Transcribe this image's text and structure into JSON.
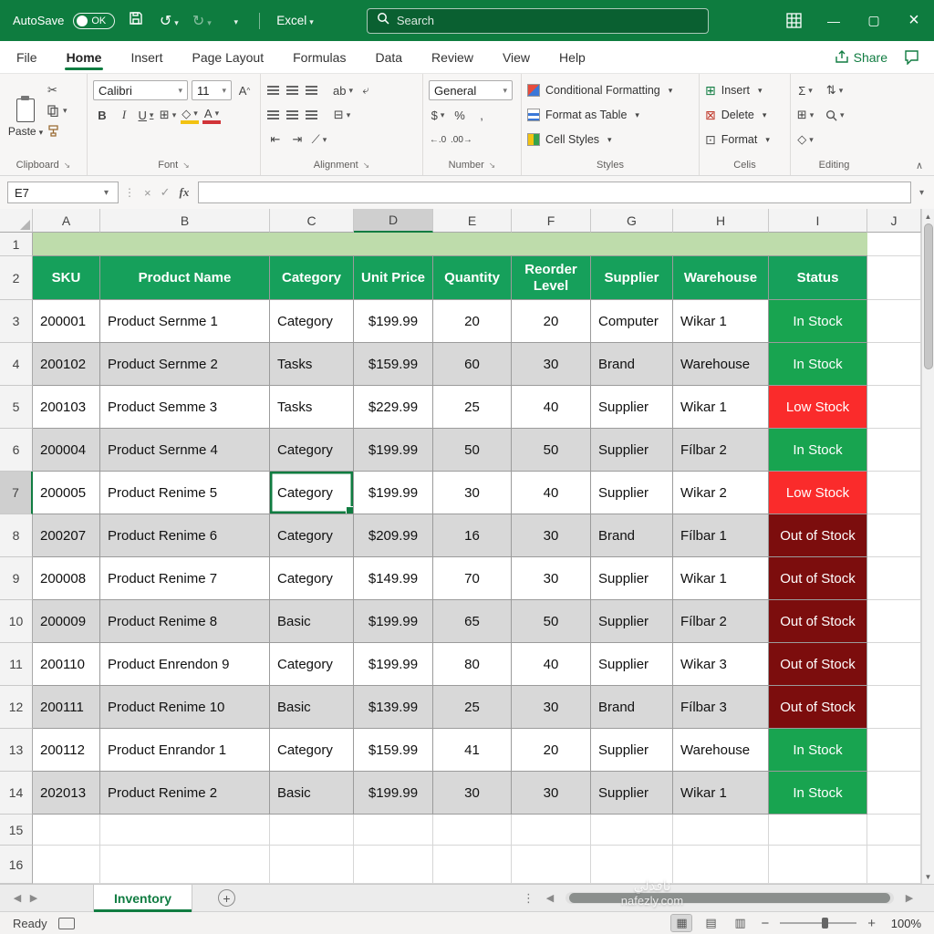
{
  "titlebar": {
    "autosave_label": "AutoSave",
    "autosave_state": "OK",
    "app_name": "Excel",
    "search_placeholder": "Search"
  },
  "menubar": {
    "tabs": [
      "File",
      "Home",
      "Insert",
      "Page Layout",
      "Formulas",
      "Data",
      "Review",
      "View",
      "Help"
    ],
    "active_tab": "Home",
    "share_label": "Share"
  },
  "ribbon": {
    "paste_label": "Paste",
    "font_name": "Calibri",
    "font_size": "11",
    "bold_label": "B",
    "italic_label": "I",
    "underline_label": "U",
    "number_format": "General",
    "currency_label": "$",
    "percent_label": "%",
    "comma_label": ",",
    "conditional_formatting_label": "Conditional Formatting",
    "format_as_table_label": "Format as Table",
    "cell_styles_label": "Cell Styles",
    "insert_label": "Insert",
    "delete_label": "Delete",
    "format_label": "Format",
    "autosum_label": "Σ",
    "group_labels": [
      "Clipboard",
      "Font",
      "Alignment",
      "Number",
      "Styles",
      "Celis",
      "Editing"
    ]
  },
  "formula_bar": {
    "name_box": "E7",
    "fx_label": "fx",
    "formula_value": ""
  },
  "grid": {
    "columns": [
      "A",
      "B",
      "C",
      "D",
      "E",
      "F",
      "G",
      "H",
      "I",
      "J"
    ],
    "row_numbers": [
      1,
      2,
      3,
      4,
      5,
      6,
      7,
      8,
      9,
      10,
      11,
      12,
      13,
      14,
      15,
      16
    ],
    "selected_column": "D",
    "selected_row": 7,
    "selected_cell": {
      "row": 7,
      "col": "C"
    },
    "headers": [
      "SKU",
      "Product Name",
      "Category",
      "Unit Price",
      "Quantity",
      "Reorder Level",
      "Supplier",
      "Warehouse",
      "Status"
    ],
    "rows": [
      {
        "cells": [
          "200001",
          "Product Sernme 1",
          "Category",
          "$199.99",
          "20",
          "20",
          "Computer",
          "Wikar 1",
          "In Stock"
        ],
        "status": "in-stock"
      },
      {
        "cells": [
          "200102",
          "Product Sernme 2",
          "Tasks",
          "$159.99",
          "60",
          "30",
          "Brand",
          "Warehouse",
          "In Stock"
        ],
        "status": "in-stock"
      },
      {
        "cells": [
          "200103",
          "Product Semme 3",
          "Tasks",
          "$229.99",
          "25",
          "40",
          "Supplier",
          "Wikar 1",
          "Low Stock"
        ],
        "status": "low-stock"
      },
      {
        "cells": [
          "200004",
          "Product Sernme 4",
          "Category",
          "$199.99",
          "50",
          "50",
          "Supplier",
          "Fílbar 2",
          "In Stock"
        ],
        "status": "in-stock"
      },
      {
        "cells": [
          "200005",
          "Product Renime 5",
          "Category",
          "$199.99",
          "30",
          "40",
          "Supplier",
          "Wikar 2",
          "Low Stock"
        ],
        "status": "low-stock"
      },
      {
        "cells": [
          "200207",
          "Product Renime 6",
          "Category",
          "$209.99",
          "16",
          "30",
          "Brand",
          "Fílbar 1",
          "Out of Stock"
        ],
        "status": "out-of-stock"
      },
      {
        "cells": [
          "200008",
          "Product Renime 7",
          "Category",
          "$149.99",
          "70",
          "30",
          "Supplier",
          "Wikar 1",
          "Out of Stock"
        ],
        "status": "out-of-stock"
      },
      {
        "cells": [
          "200009",
          "Product Renime 8",
          "Basic",
          "$199.99",
          "65",
          "50",
          "Supplier",
          "Fílbar 2",
          "Out of Stock"
        ],
        "status": "out-of-stock"
      },
      {
        "cells": [
          "200110",
          "Product Enrendon 9",
          "Category",
          "$199.99",
          "80",
          "40",
          "Supplier",
          "Wikar 3",
          "Out of Stock"
        ],
        "status": "out-of-stock"
      },
      {
        "cells": [
          "200111",
          "Product Renime 10",
          "Basic",
          "$139.99",
          "25",
          "30",
          "Brand",
          "Fílbar 3",
          "Out of Stock"
        ],
        "status": "out-of-stock"
      },
      {
        "cells": [
          "200112",
          "Product Enrandor 1",
          "Category",
          "$159.99",
          "41",
          "20",
          "Supplier",
          "Warehouse",
          "In Stock"
        ],
        "status": "in-stock"
      },
      {
        "cells": [
          "202013",
          "Product Renime 2",
          "Basic",
          "$199.99",
          "30",
          "30",
          "Supplier",
          "Wikar 1",
          "In Stock"
        ],
        "status": "in-stock"
      }
    ]
  },
  "sheet_bar": {
    "tabs": [
      {
        "label": "Inventory",
        "active": true
      }
    ]
  },
  "status_bar": {
    "mode": "Ready",
    "zoom": "100%"
  },
  "watermark": {
    "line1": "نافذلي",
    "line2": "nafezly.com"
  },
  "colors": {
    "titlebar_green": "#0E7C3F",
    "accent_green": "#107C41",
    "table_header_bg": "#16A05B",
    "banner_row_bg": "#BEDCAB",
    "banded_row_bg": "#D8D8D8",
    "in_stock_bg": "#18A450",
    "low_stock_bg": "#FA2B2B",
    "out_of_stock_bg": "#7C0D0D"
  }
}
